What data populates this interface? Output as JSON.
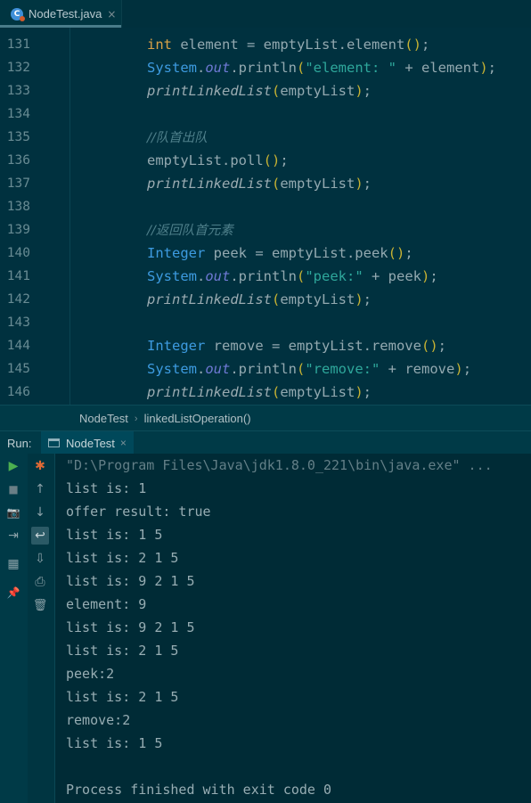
{
  "editor_tab": {
    "filename": "NodeTest.java",
    "close_glyph": "×",
    "icon_letter": "C"
  },
  "line_numbers": [
    "131",
    "132",
    "133",
    "134",
    "135",
    "136",
    "137",
    "138",
    "139",
    "140",
    "141",
    "142",
    "143",
    "144",
    "145",
    "146"
  ],
  "code": {
    "l131": {
      "kw": "int",
      "plain": " element = emptyList.element",
      "p_open": "(",
      "p_close": ")",
      "end": ";"
    },
    "l132": {
      "type": "System",
      "dot1": ".",
      "field": "out",
      "plain": ".println",
      "p_open": "(",
      "str": "\"element: \"",
      "plain2": " + element",
      "p_close": ")",
      "end": ";"
    },
    "l133": {
      "method": "printLinkedList",
      "p_open": "(",
      "arg": "emptyList",
      "p_close": ")",
      "end": ";"
    },
    "l135": {
      "comment": "//队首出队"
    },
    "l136": {
      "plain": "emptyList.poll",
      "p_open": "(",
      "p_close": ")",
      "end": ";"
    },
    "l137": {
      "method": "printLinkedList",
      "p_open": "(",
      "arg": "emptyList",
      "p_close": ")",
      "end": ";"
    },
    "l139": {
      "comment": "//返回队首元素"
    },
    "l140": {
      "type": "Integer",
      "plain": " peek = emptyList.peek",
      "p_open": "(",
      "p_close": ")",
      "end": ";"
    },
    "l141": {
      "type": "System",
      "dot1": ".",
      "field": "out",
      "plain": ".println",
      "p_open": "(",
      "str": "\"peek:\"",
      "plain2": " + peek",
      "p_close": ")",
      "end": ";"
    },
    "l142": {
      "method": "printLinkedList",
      "p_open": "(",
      "arg": "emptyList",
      "p_close": ")",
      "end": ";"
    },
    "l144": {
      "type": "Integer",
      "plain": " remove = emptyList.remove",
      "p_open": "(",
      "p_close": ")",
      "end": ";"
    },
    "l145": {
      "type": "System",
      "dot1": ".",
      "field": "out",
      "plain": ".println",
      "p_open": "(",
      "str": "\"remove:\"",
      "plain2": " + remove",
      "p_close": ")",
      "end": ";"
    },
    "l146": {
      "method": "printLinkedList",
      "p_open": "(",
      "arg": "emptyList",
      "p_close": ")",
      "end": ";"
    }
  },
  "breadcrumb": {
    "class_name": "NodeTest",
    "separator": "›",
    "method_name": "linkedListOperation()"
  },
  "run": {
    "label": "Run:",
    "tab_name": "NodeTest",
    "close_glyph": "×"
  },
  "console_lines": [
    "\"D:\\Program Files\\Java\\jdk1.8.0_221\\bin\\java.exe\" ...",
    "list is: 1",
    "offer result: true",
    "list is: 1 5",
    "list is: 2 1 5",
    "list is: 9 2 1 5",
    "element: 9",
    "list is: 9 2 1 5",
    "list is: 2 1 5",
    "peek:2",
    "list is: 2 1 5",
    "remove:2",
    "list is: 1 5",
    "",
    "Process finished with exit code 0"
  ],
  "icons": {
    "rerun": "▶",
    "stop": "■",
    "camera": "📷",
    "exit": "⇥",
    "layout": "▦",
    "pin": "📌",
    "debug": "✱",
    "up": "↑",
    "down": "↓",
    "wrap": "↩",
    "scroll_end": "⇩",
    "print": "⎙",
    "trash": "🗑"
  }
}
